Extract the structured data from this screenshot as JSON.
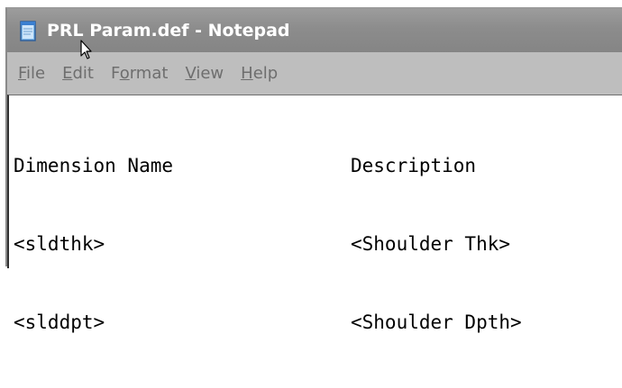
{
  "window": {
    "title": "PRL Param.def - Notepad",
    "app_icon": "notepad-icon"
  },
  "menu": {
    "items": [
      {
        "accel": "F",
        "rest": "ile"
      },
      {
        "accel": "E",
        "rest": "dit"
      },
      {
        "pre": "F",
        "accel": "o",
        "rest": "rmat"
      },
      {
        "accel": "V",
        "rest": "iew"
      },
      {
        "accel": "H",
        "rest": "elp"
      }
    ]
  },
  "document": {
    "lines": [
      {
        "left": "Dimension Name",
        "right": "Description"
      },
      {
        "left": "<sldthk>",
        "right": "<Shoulder Thk>"
      },
      {
        "left": "<slddpt>",
        "right": "<Shoulder Dpth>"
      }
    ]
  },
  "colors": {
    "titlebar": "#8c8c8c",
    "menubar": "#bebebe",
    "menu_text": "#6e6e6e",
    "editor_bg": "#ffffff"
  }
}
